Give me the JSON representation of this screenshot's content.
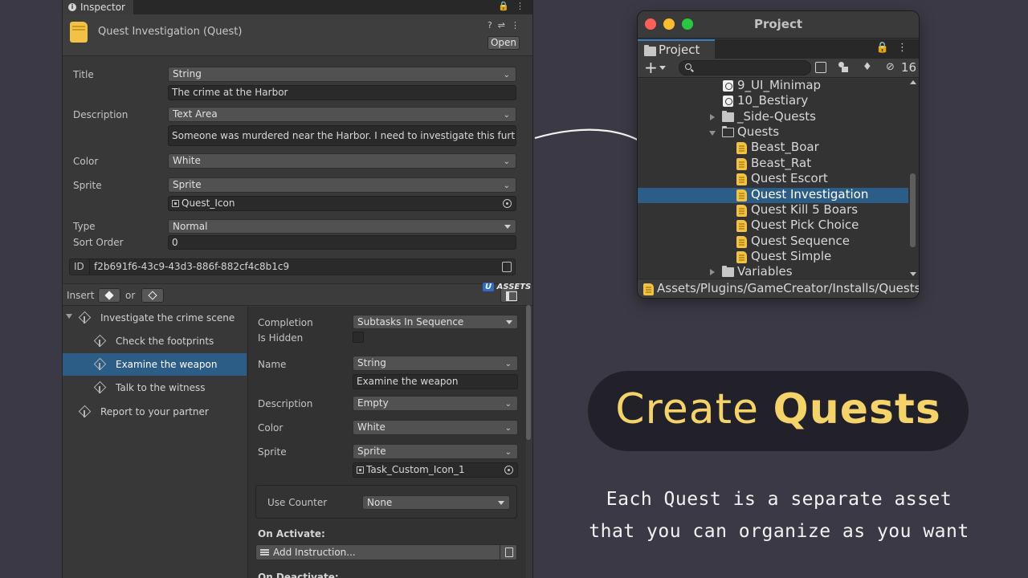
{
  "inspector": {
    "tab_label": "Inspector",
    "asset_title": "Quest Investigation (Quest)",
    "open_label": "Open",
    "fields": {
      "title_label": "Title",
      "title_type": "String",
      "title_value": "The crime at the Harbor",
      "description_label": "Description",
      "description_type": "Text Area",
      "description_value": "Someone was murdered near the Harbor. I need to investigate this further!",
      "color_label": "Color",
      "color_value": "White",
      "sprite_label": "Sprite",
      "sprite_type": "Sprite",
      "sprite_value": "Quest_Icon",
      "type_label": "Type",
      "type_value": "Normal",
      "sort_order_label": "Sort Order",
      "sort_order_value": "0",
      "id_label": "ID",
      "id_value": "f2b691f6-43c9-43d3-886f-882cf4c8b1c9"
    },
    "insert_bar": {
      "insert_label": "Insert",
      "or_label": "or",
      "watermark_u": "U",
      "watermark_text": "ASSETS"
    },
    "tasks": [
      {
        "label": "Investigate the crime scene"
      },
      {
        "label": "Check the footprints"
      },
      {
        "label": "Examine the weapon"
      },
      {
        "label": "Talk to the witness"
      },
      {
        "label": "Report to your partner"
      }
    ],
    "task_details": {
      "completion_label": "Completion",
      "completion_value": "Subtasks In Sequence",
      "is_hidden_label": "Is Hidden",
      "name_label": "Name",
      "name_type": "String",
      "name_value": "Examine the weapon",
      "description_label": "Description",
      "description_value": "Empty",
      "color_label": "Color",
      "color_value": "White",
      "sprite_label": "Sprite",
      "sprite_type": "Sprite",
      "sprite_value": "Task_Custom_Icon_1",
      "use_counter_label": "Use Counter",
      "use_counter_value": "None",
      "on_activate_label": "On Activate:",
      "add_instruction_label": "Add Instruction...",
      "on_deactivate_label": "On Deactivate:"
    }
  },
  "project": {
    "window_title": "Project",
    "tab_label": "Project",
    "hidden_count": "16",
    "items": [
      {
        "label": "9_UI_Minimap",
        "kind": "scene"
      },
      {
        "label": "10_Bestiary",
        "kind": "scene"
      },
      {
        "label": "_Side-Quests",
        "kind": "folder"
      },
      {
        "label": "Quests",
        "kind": "folder-open"
      },
      {
        "label": "Beast_Boar",
        "kind": "quest"
      },
      {
        "label": "Beast_Rat",
        "kind": "quest"
      },
      {
        "label": "Quest Escort",
        "kind": "quest"
      },
      {
        "label": "Quest Investigation",
        "kind": "quest"
      },
      {
        "label": "Quest Kill 5 Boars",
        "kind": "quest"
      },
      {
        "label": "Quest Pick Choice",
        "kind": "quest"
      },
      {
        "label": "Quest Sequence",
        "kind": "quest"
      },
      {
        "label": "Quest Simple",
        "kind": "quest"
      },
      {
        "label": "Variables",
        "kind": "folder"
      }
    ],
    "path": "Assets/Plugins/GameCreator/Installs/Quests.Exa"
  },
  "marketing": {
    "headline_light": "Create",
    "headline_bold": "Quests",
    "tagline_line1": "Each Quest is a separate asset",
    "tagline_line2": "that you can organize as you want"
  },
  "colors": {
    "background": "#3a3945",
    "selection": "#2c5d87",
    "quest_icon": "#f2c247",
    "headline": "#f5d36b",
    "pill": "#222129",
    "traffic_red": "#fe5f57",
    "traffic_yellow": "#febc2e",
    "traffic_green": "#28c840"
  }
}
